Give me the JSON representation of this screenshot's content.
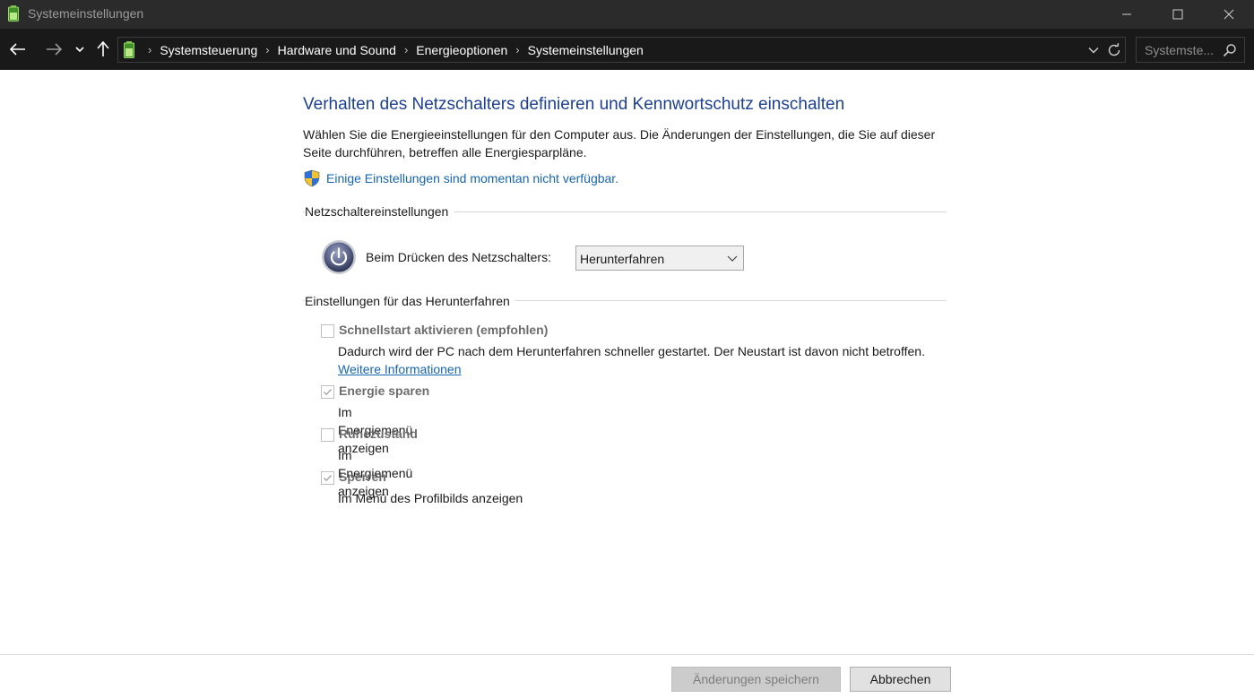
{
  "window": {
    "title": "Systemeinstellungen",
    "icons": [
      "battery-icon",
      "minimize-icon",
      "maximize-icon",
      "close-icon"
    ]
  },
  "navigation": {
    "breadcrumbs": [
      "Systemsteuerung",
      "Hardware und Sound",
      "Energieoptionen",
      "Systemeinstellungen"
    ],
    "search_placeholder": "Systemste..."
  },
  "page": {
    "heading": "Verhalten des Netzschalters definieren und Kennwortschutz einschalten",
    "intro": "Wählen Sie die Energieeinstellungen für den Computer aus. Die Änderungen der Einstellungen, die Sie auf dieser Seite durchführen, betreffen alle Energiesparpläne.",
    "unavailable_link": "Einige Einstellungen sind momentan nicht verfügbar."
  },
  "power_button_settings": {
    "group_title": "Netzschaltereinstellungen",
    "label": "Beim Drücken des Netzschalters:",
    "selected_action": "Herunterfahren"
  },
  "shutdown_settings": {
    "group_title": "Einstellungen für das Herunterfahren",
    "options": [
      {
        "title": "Schnellstart aktivieren (empfohlen)",
        "description": "Dadurch wird der PC nach dem Herunterfahren schneller gestartet. Der Neustart ist davon nicht betroffen.",
        "link": "Weitere Informationen",
        "checked": false
      },
      {
        "title": "Energie sparen",
        "description": "Im Energiemenü anzeigen",
        "checked": true
      },
      {
        "title": "Ruhezustand",
        "description": "Im Energiemenü anzeigen",
        "checked": false
      },
      {
        "title": "Sperren",
        "description": "Im Menü des Profilbilds anzeigen",
        "checked": true
      }
    ]
  },
  "footer": {
    "save_label": "Änderungen speichern",
    "cancel_label": "Abbrechen"
  },
  "colors": {
    "titlebar": "#2b2b2b",
    "addressbar": "#191919",
    "heading": "#1c3f94",
    "link": "#1665b0"
  }
}
